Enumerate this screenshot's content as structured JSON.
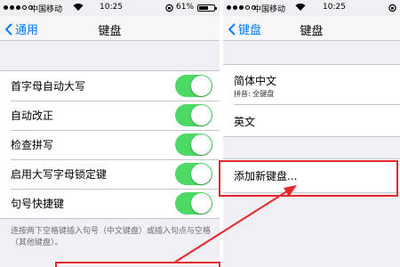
{
  "left_screen": {
    "status": {
      "carrier": "中国移动",
      "time": "10:25",
      "battery_percent": "61%",
      "battery_level": 0.61
    },
    "nav": {
      "back_label": "通用",
      "title": "键盘"
    },
    "settings": [
      {
        "label": "首字母自动大写",
        "on": true
      },
      {
        "label": "自动改正",
        "on": true
      },
      {
        "label": "检查拼写",
        "on": true
      },
      {
        "label": "启用大写字母锁定键",
        "on": true
      },
      {
        "label": "句号快捷键",
        "on": true
      }
    ],
    "footer_note": "连按两下空格键插入句号（中文键盘）或插入句点与空格（其他键盘）。"
  },
  "right_screen": {
    "status": {
      "carrier": "中国移动",
      "time": "10:25"
    },
    "nav": {
      "back_label": "键盘",
      "title": "键盘"
    },
    "keyboards": [
      {
        "name": "简体中文",
        "detail": "拼音: 全键盘"
      },
      {
        "name": "英文"
      }
    ],
    "add_keyboard_label": "添加新键盘..."
  },
  "colors": {
    "accent": "#007aff",
    "toggle_on": "#4cd964",
    "highlight": "#e5262b"
  }
}
